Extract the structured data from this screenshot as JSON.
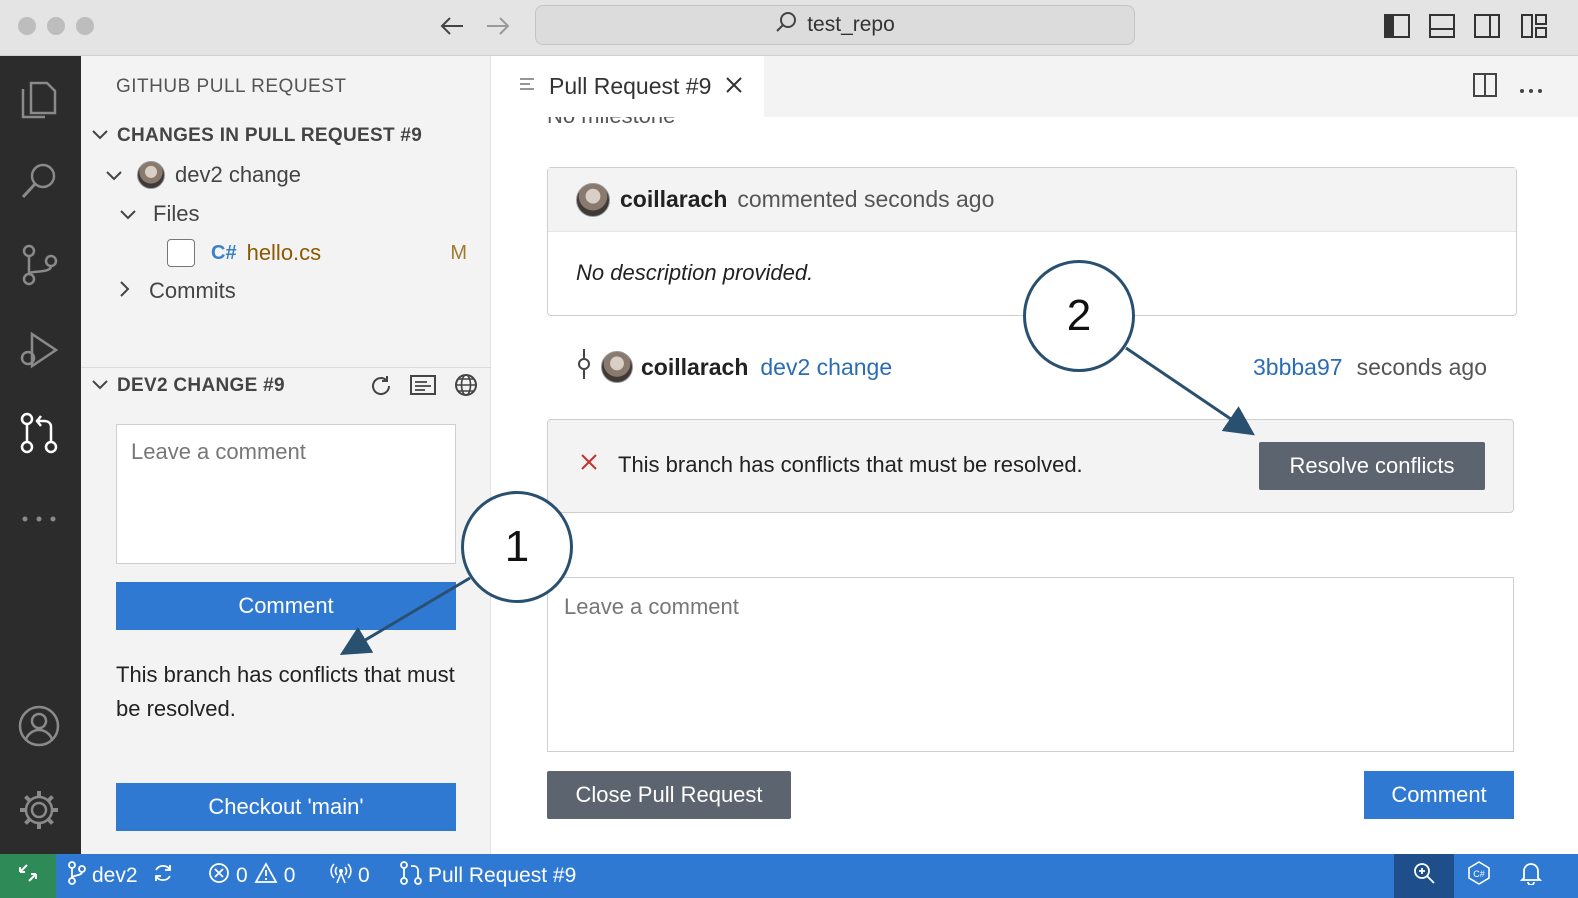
{
  "window": {
    "search_text": "test_repo"
  },
  "sidebar": {
    "title": "GITHUB PULL REQUEST",
    "changes_header": "CHANGES IN PULL REQUEST #9",
    "commit_label": "dev2 change",
    "files_label": "Files",
    "file_name": "hello.cs",
    "file_status": "M",
    "commits_label": "Commits",
    "pr_section_header": "DEV2 CHANGE #9",
    "comment_placeholder": "Leave a comment",
    "comment_button": "Comment",
    "conflict_message": "This branch has conflicts that must be resolved.",
    "checkout_button": "Checkout 'main'"
  },
  "editor": {
    "tab_label": "Pull Request #9",
    "milestone_peek": "No milestone",
    "description_card": {
      "author": "coillarach",
      "action": "commented seconds ago",
      "body": "No description provided."
    },
    "commit": {
      "author": "coillarach",
      "message": "dev2 change",
      "sha": "3bbba97",
      "time": "seconds ago"
    },
    "conflict_message": "This branch has conflicts that must be resolved.",
    "resolve_button": "Resolve conflicts",
    "comment_placeholder": "Leave a comment",
    "close_button": "Close Pull Request",
    "comment_button": "Comment"
  },
  "statusbar": {
    "branch": "dev2",
    "errors": "0",
    "warnings": "0",
    "ports": "0",
    "pr_label": "Pull Request #9"
  },
  "callouts": {
    "one": "1",
    "two": "2"
  },
  "colors": {
    "accent": "#2f79d2",
    "activity_bar": "#2c2c2c",
    "link": "#2a6db5",
    "error": "#c4332b",
    "callout_stroke": "#2a5070"
  }
}
